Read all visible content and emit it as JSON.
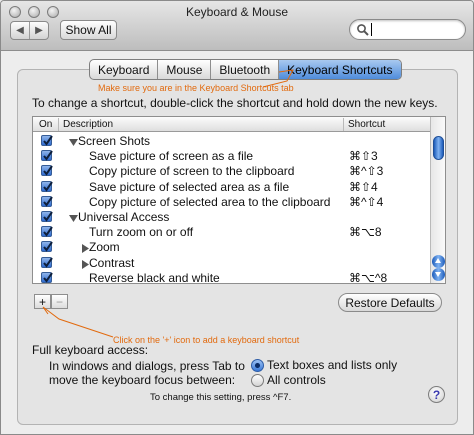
{
  "window": {
    "title": "Keyboard & Mouse"
  },
  "toolbar": {
    "back_icon": "chevron-left-icon",
    "forward_icon": "chevron-right-icon",
    "show_all_label": "Show All",
    "search_value": "",
    "search_icon": "magnifier-icon"
  },
  "tabs": [
    {
      "label": "Keyboard",
      "active": false
    },
    {
      "label": "Mouse",
      "active": false
    },
    {
      "label": "Bluetooth",
      "active": false
    },
    {
      "label": "Keyboard Shortcuts",
      "active": true
    }
  ],
  "annotations": {
    "tab_note": "Make sure you are in the Keyboard Shortcuts tab",
    "plus_note": "Click on the '+' icon to add a keyboard shortcut",
    "color": "#e26a0e"
  },
  "instructions": "To change a shortcut, double-click the shortcut and hold down the new keys.",
  "table": {
    "columns": {
      "on": "On",
      "description": "Description",
      "shortcut": "Shortcut"
    },
    "rows": [
      {
        "checked": true,
        "level": 0,
        "disclosure": "open",
        "description": "Screen Shots",
        "shortcut": ""
      },
      {
        "checked": true,
        "level": 1,
        "disclosure": "",
        "description": "Save picture of screen as a file",
        "shortcut": "⌘⇧3"
      },
      {
        "checked": true,
        "level": 1,
        "disclosure": "",
        "description": "Copy picture of screen to the clipboard",
        "shortcut": "⌘^⇧3"
      },
      {
        "checked": true,
        "level": 1,
        "disclosure": "",
        "description": "Save picture of selected area as a file",
        "shortcut": "⌘⇧4"
      },
      {
        "checked": true,
        "level": 1,
        "disclosure": "",
        "description": "Copy picture of selected area to the clipboard",
        "shortcut": "⌘^⇧4"
      },
      {
        "checked": true,
        "level": 0,
        "disclosure": "open",
        "description": "Universal Access",
        "shortcut": ""
      },
      {
        "checked": true,
        "level": 1,
        "disclosure": "",
        "description": "Turn zoom on or off",
        "shortcut": "⌘⌥8"
      },
      {
        "checked": true,
        "level": 1,
        "disclosure": "closed",
        "description": "Zoom",
        "shortcut": ""
      },
      {
        "checked": true,
        "level": 1,
        "disclosure": "closed",
        "description": "Contrast",
        "shortcut": ""
      },
      {
        "checked": true,
        "level": 1,
        "disclosure": "",
        "description": "Reverse black and white",
        "shortcut": "⌘⌥^8"
      }
    ]
  },
  "buttons": {
    "add": "+",
    "remove": "−",
    "restore": "Restore Defaults"
  },
  "full_keyboard_access": {
    "label": "Full keyboard access:",
    "line1": "In windows and dialogs, press Tab to",
    "line2": "move the keyboard focus between:",
    "options": [
      {
        "label": "Text boxes and lists only",
        "selected": true
      },
      {
        "label": "All controls",
        "selected": false
      }
    ],
    "note": "To change this setting, press ^F7.",
    "help": "?"
  }
}
